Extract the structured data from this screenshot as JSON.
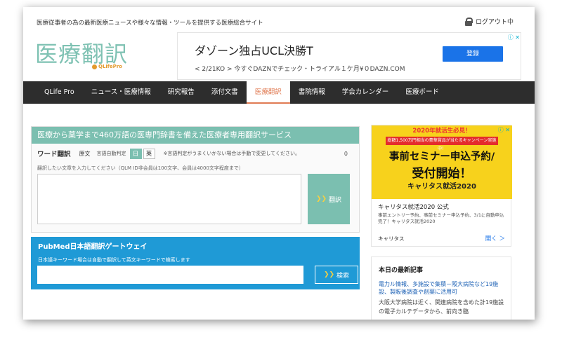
{
  "header": {
    "tagline": "医療従事者の為の最新医療ニュースや様々な情報・ツールを提供する医療総合サイト",
    "logout": "ログアウト中",
    "logo": "医療翻訳",
    "logo_sub": "QLifePro"
  },
  "top_ad": {
    "title": "ダゾーン独占UCL決勝T",
    "text": "< 2/21KO > 今すぐDAZNでチェック・トライアル１ケ月¥０DAZN.COM",
    "button": "登録"
  },
  "nav": {
    "items": [
      "QLife Pro",
      "ニュース・医療情報",
      "研究報告",
      "添付文書",
      "医療翻訳",
      "書院情報",
      "学会カレンダー",
      "医療ボード"
    ],
    "active_index": 4
  },
  "translator": {
    "header": "医療から薬学まで460万語の医専門辞書を備えた医療者専用翻訳サービス",
    "word_label": "ワード翻訳",
    "source_label": "原文",
    "auto_label": "言語自動判定",
    "lang_ja": "日",
    "lang_en": "英",
    "note": "※言語判定がうまくいかない場合は手動で変更してください。",
    "count": "0",
    "hint": "翻訳したい文章を入力してください（QLM ID非会員は100文字、会員は4000文字程度まで）",
    "button": "翻訳"
  },
  "pubmed": {
    "header": "PubMed日本語翻訳ゲートウェイ",
    "hint": "日本語キーワード場合は自動で翻訳して英文キーワードで検索します",
    "button": "検索"
  },
  "side_ad": {
    "top": "2020年就活生必見！",
    "red": "総額1,500万円相当の豪華賞品が当たるキャンペーン実施中！",
    "main1": "事前セミナー申込予約/",
    "main2": "受付開始！",
    "brand": "キャリタス就活2020",
    "brand_sub": "キャリタス就活2020 公式",
    "title": "キャリタス就活2020 公式",
    "desc": "事前エントリー予約、事前セミナー申込予約、3/1に自動申込完了！キャリタス就活2020",
    "foot": "キャリタス",
    "open": "開く ＞"
  },
  "news": {
    "title": "本日の最新記事",
    "link": "電力ル情報、多施設で集積－阪大病院など19施設、製販後調査や創薬に活用可",
    "body": "大阪大学病院は近く、関連病院を含めた計19施設の電子カルテデータから、前向き臨"
  },
  "colors": {
    "teal": "#7bbfb0",
    "nav_bg": "#2d2d2d",
    "accent": "#e07b53",
    "pubmed_blue": "#1f9ad6",
    "ad_yellow": "#f7d21c"
  }
}
